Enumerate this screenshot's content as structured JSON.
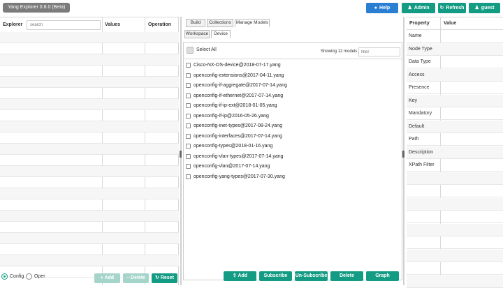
{
  "header": {
    "app_title": "Yang Explorer 0.8.0 (Beta)",
    "buttons": {
      "help": "Help",
      "admin": "Admin",
      "refresh": "Refresh",
      "user": "guest"
    },
    "icons": {
      "help": "github-icon",
      "admin": "users-icon",
      "refresh": "refresh-icon",
      "user": "user-icon"
    }
  },
  "explorer": {
    "columns": {
      "explorer": "Explorer",
      "values": "Values",
      "operation": "Operation"
    },
    "search_placeholder": "search",
    "mode_options": [
      "Config",
      "Oper"
    ],
    "selected_mode": "Config",
    "buttons": {
      "add": "Add",
      "delete": "Delete",
      "reset": "Reset"
    }
  },
  "center": {
    "tabs": [
      "Build",
      "Collections",
      "Manage Models"
    ],
    "active_tab": "Manage Models",
    "subtabs": [
      "Workspace",
      "Device"
    ],
    "active_subtab": "Device",
    "select_all_label": "Select All",
    "showing_text": "Showing 12 models",
    "filter_placeholder": "filter",
    "models": [
      "Cisco-NX-OS-device@2018-07-17.yang",
      "openconfig-extensions@2017-04-11.yang",
      "openconfig-if-aggregate@2017-07-14.yang",
      "openconfig-if-ethernet@2017-07-14.yang",
      "openconfig-if-ip-ext@2018-01-05.yang",
      "openconfig-if-ip@2016-05-26.yang",
      "openconfig-inet-types@2017-08-24.yang",
      "openconfig-interfaces@2017-07-14.yang",
      "openconfig-types@2018-01-16.yang",
      "openconfig-vlan-types@2017-07-14.yang",
      "openconfig-vlan@2017-07-14.yang",
      "openconfig-yang-types@2017-07-30.yang"
    ],
    "buttons": {
      "add": "Add",
      "subscribe": "Subscribe",
      "unsubscribe": "Un-Subscribe",
      "delete": "Delete",
      "graph": "Graph"
    }
  },
  "properties": {
    "columns": {
      "property": "Property",
      "value": "Value"
    },
    "rows": [
      "Name",
      "Node Type",
      "Data Type",
      "Access",
      "Presence",
      "Key",
      "Mandatory",
      "Default",
      "Path",
      "Description",
      "XPath Filter"
    ]
  },
  "colors": {
    "accent": "#139b83",
    "help": "#2a7fd3",
    "title_bg": "#7b7b7b",
    "disabled": "#a5d4ca"
  }
}
